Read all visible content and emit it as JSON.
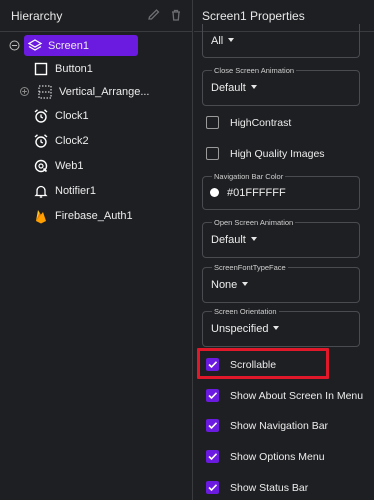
{
  "hierarchy": {
    "title": "Hierarchy",
    "items": [
      {
        "label": "Screen1",
        "icon": "layers-icon",
        "selected": true
      },
      {
        "label": "Button1",
        "icon": "button-icon"
      },
      {
        "label": "Vertical_Arrange...",
        "icon": "vertical-arrangement-icon"
      },
      {
        "label": "Clock1",
        "icon": "alarm-clock-icon"
      },
      {
        "label": "Clock2",
        "icon": "alarm-clock-icon"
      },
      {
        "label": "Web1",
        "icon": "web-icon"
      },
      {
        "label": "Notifier1",
        "icon": "bell-icon"
      },
      {
        "label": "Firebase_Auth1",
        "icon": "firebase-icon"
      }
    ]
  },
  "properties": {
    "title": "Screen1 Properties",
    "top_value": "All",
    "close_screen_animation": {
      "label": "Close Screen Animation",
      "value": "Default"
    },
    "high_contrast": {
      "label": "HighContrast",
      "checked": false
    },
    "high_quality_images": {
      "label": "High Quality Images",
      "checked": false
    },
    "navigation_bar_color": {
      "label": "Navigation Bar Color",
      "value": "#01FFFFFF",
      "swatch": "#ffffff"
    },
    "open_screen_animation": {
      "label": "Open Screen Animation",
      "value": "Default"
    },
    "screen_font_typeface": {
      "label": "ScreenFontTypeFace",
      "value": "None"
    },
    "screen_orientation": {
      "label": "Screen Orientation",
      "value": "Unspecified"
    },
    "scrollable": {
      "label": "Scrollable",
      "checked": true
    },
    "show_about_screen_in_menu": {
      "label": "Show About Screen In Menu",
      "checked": true
    },
    "show_navigation_bar": {
      "label": "Show Navigation Bar",
      "checked": true
    },
    "show_options_menu": {
      "label": "Show Options Menu",
      "checked": true
    },
    "show_status_bar": {
      "label": "Show Status Bar",
      "checked": true
    }
  },
  "colors": {
    "accent": "#6b1ae0",
    "highlight": "#e0182a",
    "background": "#1e1f22"
  }
}
